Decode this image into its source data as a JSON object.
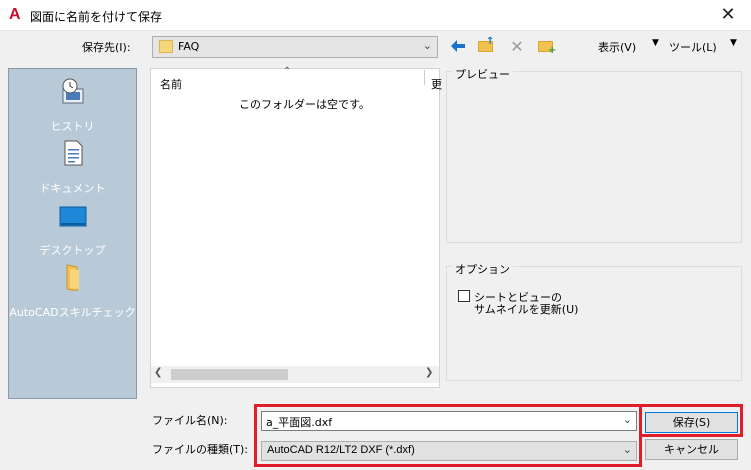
{
  "window": {
    "title": "図面に名前を付けて保存"
  },
  "toolbar": {
    "save_in_label": "保存先(I):",
    "save_in_value": "FAQ",
    "view_label": "表示(V)",
    "tools_label": "ツール(L)"
  },
  "places": [
    {
      "label": "ヒストリ",
      "icon": "history-icon"
    },
    {
      "label": "ドキュメント",
      "icon": "documents-icon"
    },
    {
      "label": "デスクトップ",
      "icon": "desktop-icon"
    },
    {
      "label": "AutoCADスキルチェック",
      "icon": "folder-icon"
    }
  ],
  "file_list": {
    "column_name": "名前",
    "column_2": "更",
    "empty_message": "このフォルダーは空です。"
  },
  "preview": {
    "title": "プレビュー"
  },
  "options": {
    "title": "オプション",
    "thumbnail_label_line1": "シートとビューの",
    "thumbnail_label_line2": "サムネイルを更新(U)",
    "thumbnail_checked": false
  },
  "bottom": {
    "filename_label": "ファイル名(N):",
    "filename_value": "a_平面図.dxf",
    "filetype_label": "ファイルの種類(T):",
    "filetype_value": "AutoCAD R12/LT2 DXF (*.dxf)",
    "save_button": "保存(S)",
    "cancel_button": "キャンセル"
  },
  "colors": {
    "highlight": "#e01e2b",
    "accent": "#0078d7",
    "places_bg": "#b8c9d8"
  }
}
